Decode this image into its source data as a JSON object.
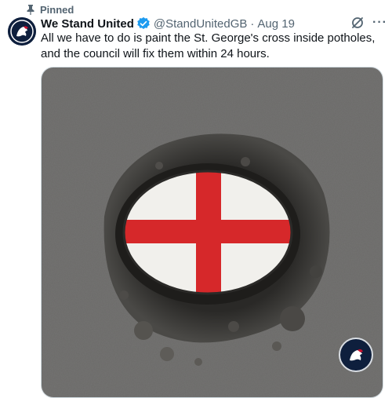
{
  "pinned": {
    "label": "Pinned"
  },
  "author": {
    "display_name": "We Stand United",
    "handle": "@StandUnitedGB",
    "separator": "·",
    "date": "Aug 19",
    "verified": true
  },
  "tweet": {
    "text": "All we have to do is paint the St. George's cross inside potholes, and the council will fix them within 24 hours."
  },
  "icons": {
    "pin": "pin-icon",
    "verified": "verified-badge-icon",
    "grok": "grok-icon",
    "more": "more-options-icon"
  },
  "colors": {
    "verified_blue": "#1d9bf0",
    "secondary_text": "#536471",
    "cross_red": "#d6282a",
    "asphalt": "#6b6a68"
  },
  "more_glyph": "···"
}
